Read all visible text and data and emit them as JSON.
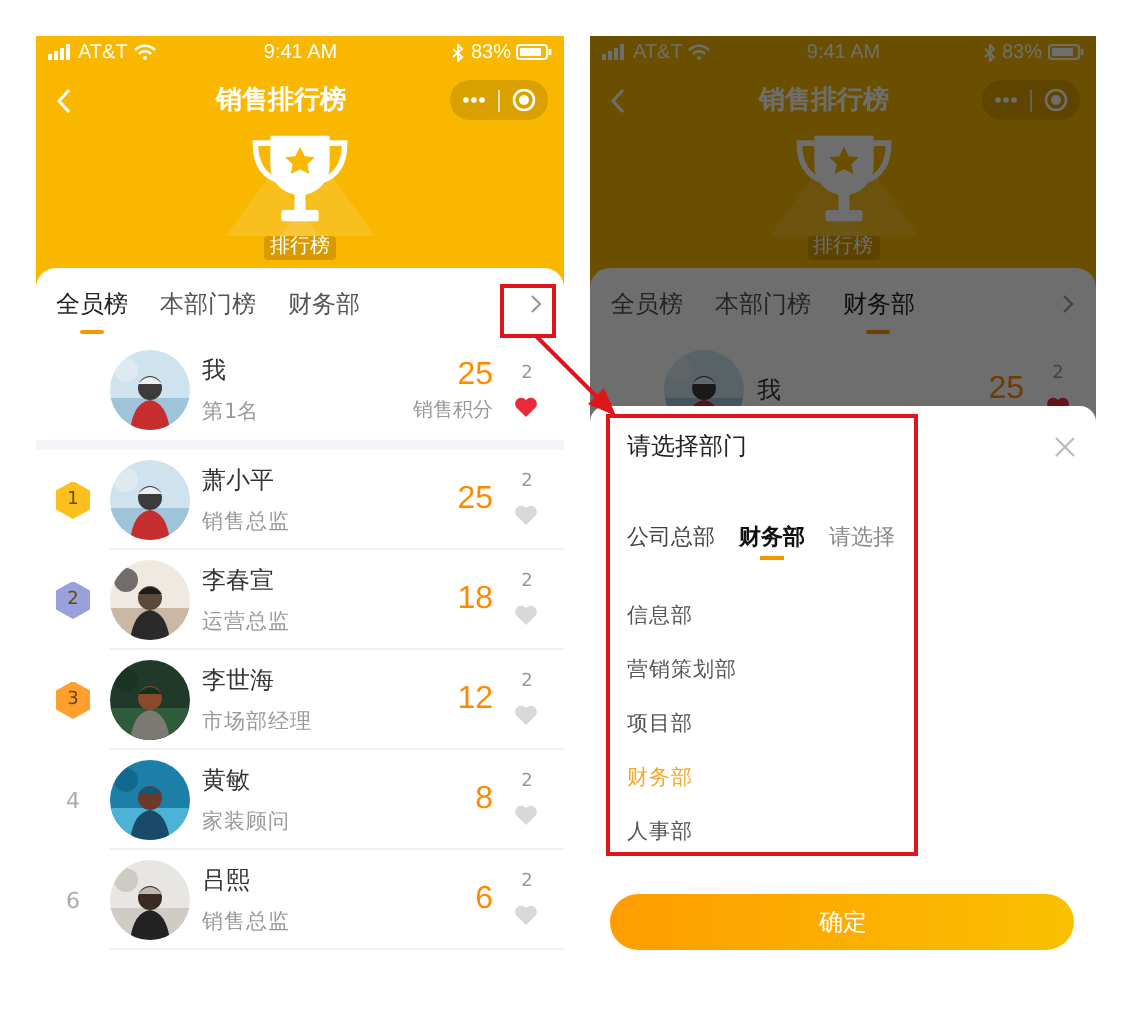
{
  "left_screen": {
    "status_bar": {
      "carrier": "AT&T",
      "time": "9:41 AM",
      "battery": "83%"
    },
    "nav": {
      "title": "销售排行榜"
    },
    "trophy_label": "排行榜",
    "tabs": [
      {
        "label": "全员榜",
        "selected": true
      },
      {
        "label": "本部门榜",
        "selected": false
      },
      {
        "label": "财务部",
        "selected": false
      }
    ],
    "me": {
      "name": "我",
      "rank_text": "第1名",
      "score": "25",
      "score_label": "销售积分",
      "likes": "2",
      "liked": true
    },
    "rows": [
      {
        "kind": "medal",
        "rank": "1",
        "color": "#fbbf1e",
        "name": "萧小平",
        "title": "销售总监",
        "score": "25",
        "likes": "2",
        "liked": false
      },
      {
        "kind": "medal",
        "rank": "2",
        "color": "#9aa0dc",
        "name": "李春宣",
        "title": "运营总监",
        "score": "18",
        "likes": "2",
        "liked": false
      },
      {
        "kind": "medal",
        "rank": "3",
        "color": "#ff9f2e",
        "name": "李世海",
        "title": "市场部经理",
        "score": "12",
        "likes": "2",
        "liked": false
      },
      {
        "kind": "plain",
        "rank": "4",
        "name": "黄敏",
        "title": "家装顾问",
        "score": "8",
        "likes": "2",
        "liked": false
      },
      {
        "kind": "plain",
        "rank": "6",
        "name": "吕熙",
        "title": "销售总监",
        "score": "6",
        "likes": "2",
        "liked": false
      }
    ]
  },
  "right_screen": {
    "status_bar": {
      "carrier": "AT&T",
      "time": "9:41 AM",
      "battery": "83%"
    },
    "nav": {
      "title": "销售排行榜"
    },
    "trophy_label": "排行榜",
    "tabs": [
      {
        "label": "全员榜",
        "selected": false
      },
      {
        "label": "本部门榜",
        "selected": false
      },
      {
        "label": "财务部",
        "selected": true
      }
    ],
    "me": {
      "name": "我",
      "score": "25",
      "likes": "2",
      "liked": true
    },
    "sheet": {
      "title": "请选择部门",
      "steps": [
        {
          "label": "公司总部",
          "kind": "chosen",
          "selected": false
        },
        {
          "label": "财务部",
          "kind": "chosen",
          "selected": true
        },
        {
          "label": "请选择",
          "kind": "prompt",
          "selected": false
        }
      ],
      "options": [
        {
          "label": "信息部",
          "selected": false
        },
        {
          "label": "营销策划部",
          "selected": false
        },
        {
          "label": "项目部",
          "selected": false
        },
        {
          "label": "财务部",
          "selected": true
        },
        {
          "label": "人事部",
          "selected": false
        }
      ],
      "confirm": "确定"
    }
  }
}
